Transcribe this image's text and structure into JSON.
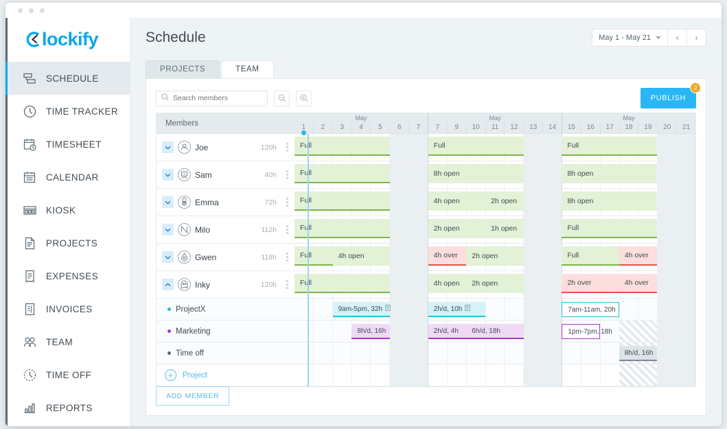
{
  "app": {
    "logo_text": "lockify"
  },
  "sidebar": {
    "items": [
      {
        "label": "SCHEDULE",
        "icon": "schedule-icon",
        "active": true
      },
      {
        "label": "TIME TRACKER",
        "icon": "clock-icon",
        "active": false
      },
      {
        "label": "TIMESHEET",
        "icon": "timesheet-icon",
        "active": false
      },
      {
        "label": "CALENDAR",
        "icon": "calendar-icon",
        "active": false
      },
      {
        "label": "KIOSK",
        "icon": "kiosk-icon",
        "active": false
      },
      {
        "label": "PROJECTS",
        "icon": "document-icon",
        "active": false
      },
      {
        "label": "EXPENSES",
        "icon": "receipt-icon",
        "active": false
      },
      {
        "label": "INVOICES",
        "icon": "invoice-icon",
        "active": false
      },
      {
        "label": "TEAM",
        "icon": "people-icon",
        "active": false
      },
      {
        "label": "TIME OFF",
        "icon": "timeoff-clock-icon",
        "active": false
      },
      {
        "label": "REPORTS",
        "icon": "bar-chart-icon",
        "active": false
      }
    ]
  },
  "header": {
    "title": "Schedule",
    "date_range": "May 1 - May 21",
    "prev_label": "‹",
    "next_label": "›"
  },
  "tabs": [
    {
      "label": "PROJECTS",
      "active": false
    },
    {
      "label": "TEAM",
      "active": true
    }
  ],
  "toolbar": {
    "search_placeholder": "Search members",
    "search_value": "",
    "zoom_out_icon": "zoom-out-icon",
    "zoom_in_icon": "zoom-in-icon",
    "publish_label": "PUBLISH",
    "publish_badge": "2"
  },
  "grid": {
    "members_header": "Members",
    "weeks": [
      {
        "month": "May",
        "days": [
          "1",
          "2",
          "3",
          "4",
          "5",
          "6",
          "7"
        ],
        "weekend": [
          5,
          6
        ]
      },
      {
        "month": "May",
        "days": [
          "7",
          "9",
          "10",
          "11",
          "12",
          "13",
          "14"
        ],
        "weekend": [
          5,
          6
        ]
      },
      {
        "month": "May",
        "days": [
          "15",
          "16",
          "17",
          "18",
          "19",
          "20",
          "21"
        ],
        "weekend": [
          5,
          6
        ]
      }
    ]
  },
  "members": [
    {
      "name": "Joe",
      "hours": "120h",
      "expanded": false,
      "avatar": "person-avatar",
      "bars": [
        {
          "label": "Full",
          "type": "green",
          "week": 0,
          "start": 0,
          "span": 5
        },
        {
          "label": "Full",
          "type": "green",
          "week": 1,
          "start": 0,
          "span": 5
        },
        {
          "label": "Full",
          "type": "green",
          "week": 2,
          "start": 0,
          "span": 5
        }
      ]
    },
    {
      "name": "Sam",
      "hours": "40h",
      "expanded": false,
      "avatar": "monitor-avatar",
      "bars": [
        {
          "label": "Full",
          "type": "green",
          "week": 0,
          "start": 0,
          "span": 5
        },
        {
          "label": "8h open",
          "type": "greenlight",
          "week": 1,
          "start": 0,
          "span": 5
        },
        {
          "label": "8h open",
          "type": "greenlight",
          "week": 2,
          "start": 0,
          "span": 5
        }
      ]
    },
    {
      "name": "Emma",
      "hours": "72h",
      "expanded": false,
      "avatar": "snail-avatar",
      "bars": [
        {
          "label": "Full",
          "type": "green",
          "week": 0,
          "start": 0,
          "span": 5
        },
        {
          "label": "4h open",
          "type": "greenlight",
          "week": 1,
          "start": 0,
          "span": 3
        },
        {
          "label": "2h open",
          "type": "greenlight",
          "week": 1,
          "start": 3,
          "span": 2
        },
        {
          "label": "8h open",
          "type": "greenlight",
          "week": 2,
          "start": 0,
          "span": 5
        }
      ]
    },
    {
      "name": "Milo",
      "hours": "112h",
      "expanded": false,
      "avatar": "shape-avatar",
      "bars": [
        {
          "label": "Full",
          "type": "green",
          "week": 0,
          "start": 0,
          "span": 5
        },
        {
          "label": "2h open",
          "type": "greenlight",
          "week": 1,
          "start": 0,
          "span": 3
        },
        {
          "label": "1h open",
          "type": "greenlight",
          "week": 1,
          "start": 3,
          "span": 2
        },
        {
          "label": "Full",
          "type": "green",
          "week": 2,
          "start": 0,
          "span": 5
        }
      ]
    },
    {
      "name": "Gwen",
      "hours": "118h",
      "expanded": false,
      "avatar": "drop-avatar",
      "bars": [
        {
          "label": "Full",
          "type": "green",
          "week": 0,
          "start": 0,
          "span": 2
        },
        {
          "label": "4h open",
          "type": "greenlight",
          "week": 0,
          "start": 2,
          "span": 3
        },
        {
          "label": "4h over",
          "type": "red",
          "week": 1,
          "start": 0,
          "span": 2
        },
        {
          "label": "2h open",
          "type": "greenlight",
          "week": 1,
          "start": 2,
          "span": 3
        },
        {
          "label": "Full",
          "type": "green",
          "week": 2,
          "start": 0,
          "span": 3
        },
        {
          "label": "4h over",
          "type": "red",
          "week": 2,
          "start": 3,
          "span": 2
        }
      ]
    },
    {
      "name": "Inky",
      "hours": "120h",
      "expanded": true,
      "avatar": "ghost-avatar",
      "bars": [
        {
          "label": "Full",
          "type": "green",
          "week": 0,
          "start": 0,
          "span": 5
        },
        {
          "label": "4h open",
          "type": "greenlight",
          "week": 1,
          "start": 0,
          "span": 2
        },
        {
          "label": "2h open",
          "type": "greenlight",
          "week": 1,
          "start": 2,
          "span": 3
        },
        {
          "label": "2h over",
          "type": "red",
          "week": 2,
          "start": 0,
          "span": 3
        },
        {
          "label": "4h over",
          "type": "red",
          "week": 2,
          "start": 3,
          "span": 2
        }
      ]
    }
  ],
  "projects": [
    {
      "name": "ProjectX",
      "color": "#22c0db",
      "bars": [
        {
          "label": "9am-5pm, 32h",
          "type": "cyan",
          "note_icon": "note-icon",
          "week": 0,
          "start": 2,
          "span": 3
        },
        {
          "label": "2h/d, 10h",
          "type": "cyan",
          "note_icon": "note-icon",
          "week": 1,
          "start": 0,
          "span": 3
        },
        {
          "label": "7am-11am, 20h",
          "type": "out-cyan",
          "note_icon": "",
          "week": 2,
          "start": 0,
          "span": 3
        }
      ]
    },
    {
      "name": "Marketing",
      "color": "#aa35c4",
      "bars": [
        {
          "label": "8h/d, 16h",
          "type": "purple",
          "note_icon": "",
          "week": 0,
          "start": 3,
          "span": 2
        },
        {
          "label": "2h/d, 4h",
          "type": "purple",
          "note_icon": "",
          "week": 1,
          "start": 0,
          "span": 2
        },
        {
          "label": "6h/d, 18h",
          "type": "purple",
          "note_icon": "",
          "week": 1,
          "start": 2,
          "span": 3
        },
        {
          "label": "1pm-7pm, 18h",
          "type": "out-purple",
          "note_icon": "",
          "week": 2,
          "start": 0,
          "span": 2
        }
      ]
    },
    {
      "name": "Time off",
      "color": "#5b6974",
      "bars": [
        {
          "label": "8h/d, 16h",
          "type": "gray",
          "note_icon": "",
          "week": 2,
          "start": 3,
          "span": 2
        }
      ]
    }
  ],
  "add_project": {
    "label": "Project",
    "icon": "plus-circle-icon"
  },
  "add_member": {
    "label": "ADD MEMBER"
  },
  "colors": {
    "accent": "#29b6f6",
    "green_bar": "#e3f1d6",
    "green_line": "#7ab648",
    "red_bar": "#fbdedd",
    "red_line": "#e0524d",
    "cyan": "#22c0db",
    "purple": "#aa35c4",
    "badge": "#f5a623"
  }
}
